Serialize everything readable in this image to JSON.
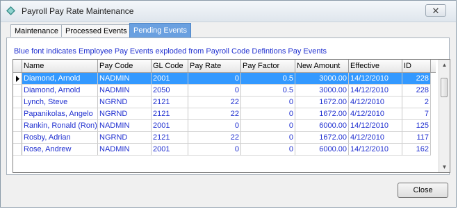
{
  "window": {
    "title": "Payroll Pay Rate Maintenance"
  },
  "tabs": [
    {
      "label": "Maintenance"
    },
    {
      "label": "Processed Events"
    },
    {
      "label": "Pending Events"
    }
  ],
  "info_text": "Blue font indicates Employee Pay Events exploded from Payroll Code Defintions Pay Events",
  "grid": {
    "columns": [
      "Name",
      "Pay Code",
      "GL Code",
      "Pay Rate",
      "Pay Factor",
      "New Amount",
      "Effective",
      "ID"
    ],
    "rows": [
      [
        "Diamond, Arnold",
        "NADMIN",
        "2001",
        "0",
        "0.5",
        "3000.00",
        "14/12/2010",
        "228"
      ],
      [
        "Diamond, Arnold",
        "NADMIN",
        "2050",
        "0",
        "0.5",
        "3000.00",
        "14/12/2010",
        "228"
      ],
      [
        "Lynch, Steve",
        "NGRND",
        "2121",
        "22",
        "0",
        "1672.00",
        "4/12/2010",
        "2"
      ],
      [
        "Papanikolas, Angelo",
        "NGRND",
        "2121",
        "22",
        "0",
        "1672.00",
        "4/12/2010",
        "7"
      ],
      [
        "Rankin, Ronald (Ron)",
        "NADMIN",
        "2001",
        "0",
        "0",
        "6000.00",
        "14/12/2010",
        "125"
      ],
      [
        "Rosby, Adrian",
        "NGRND",
        "2121",
        "22",
        "0",
        "1672.00",
        "4/12/2010",
        "117"
      ],
      [
        "Rose, Andrew",
        "NADMIN",
        "2001",
        "0",
        "0",
        "6000.00",
        "14/12/2010",
        "162"
      ]
    ],
    "selected_row": 0
  },
  "buttons": {
    "close": "Close"
  },
  "colors": {
    "data_text": "#1f2fd0",
    "selection": "#3399ff",
    "active_tab": "#6aa0e0"
  }
}
